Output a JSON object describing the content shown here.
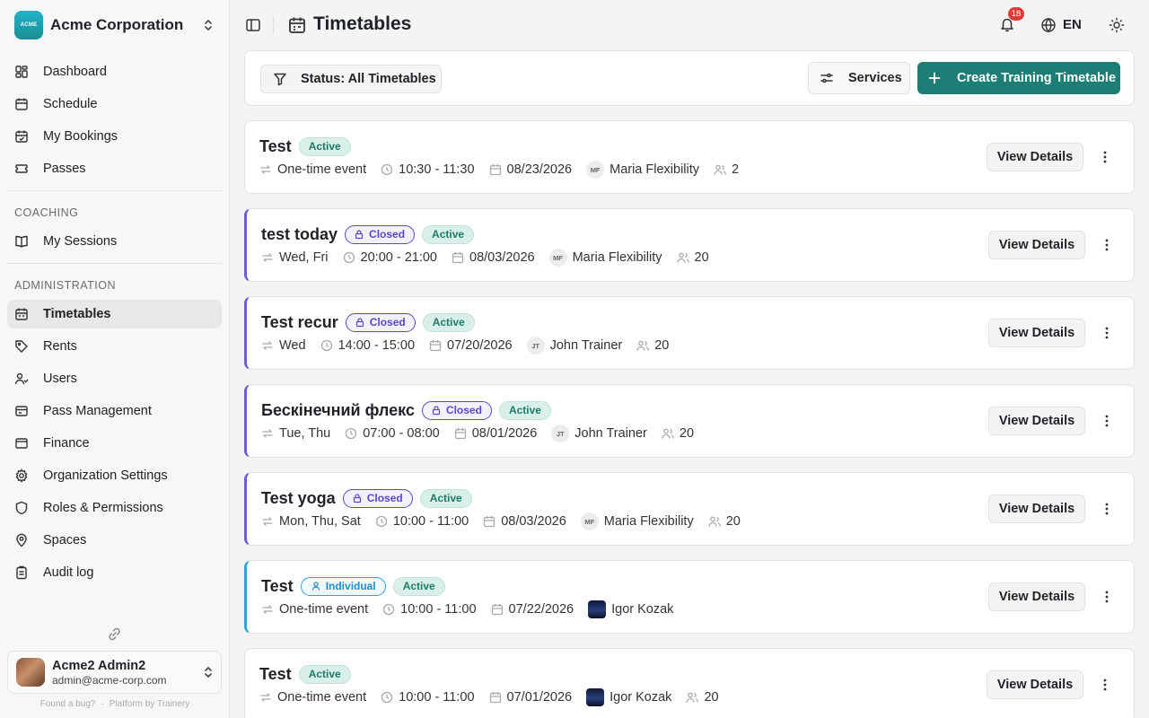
{
  "org": {
    "logo_text": "ACME",
    "name": "Acme Corporation"
  },
  "sidebar": {
    "main_items": [
      {
        "label": "Dashboard",
        "icon": "dashboard-icon"
      },
      {
        "label": "Schedule",
        "icon": "calendar-icon"
      },
      {
        "label": "My Bookings",
        "icon": "bookings-icon"
      },
      {
        "label": "Passes",
        "icon": "ticket-icon"
      }
    ],
    "coaching_heading": "COACHING",
    "coaching_items": [
      {
        "label": "My Sessions",
        "icon": "book-icon"
      }
    ],
    "admin_heading": "ADMINISTRATION",
    "admin_items": [
      {
        "label": "Timetables",
        "icon": "calendar-icon",
        "active": true
      },
      {
        "label": "Rents",
        "icon": "tag-icon"
      },
      {
        "label": "Users",
        "icon": "users-icon"
      },
      {
        "label": "Pass Management",
        "icon": "ticket-icon"
      },
      {
        "label": "Finance",
        "icon": "wallet-icon"
      },
      {
        "label": "Organization Settings",
        "icon": "gear-icon"
      },
      {
        "label": "Roles & Permissions",
        "icon": "shield-icon"
      },
      {
        "label": "Spaces",
        "icon": "map-pin-icon"
      },
      {
        "label": "Audit log",
        "icon": "clipboard-icon"
      }
    ]
  },
  "user": {
    "name": "Acme2 Admin2",
    "email": "admin@acme-corp.com"
  },
  "footer": {
    "bug_link": "Found a bug?",
    "separator": "·",
    "platform": "Platform by Trainery"
  },
  "header": {
    "title": "Timetables",
    "notifications_count": "18",
    "language": "EN"
  },
  "toolbar": {
    "status_filter": "Status: All Timetables",
    "services_label": "Services",
    "create_label": "Create Training Timetable"
  },
  "timetables": [
    {
      "title": "Test",
      "badges": [
        {
          "type": "active",
          "label": "Active"
        }
      ],
      "accent": "none",
      "recurrence": "One-time event",
      "time": "10:30 - 11:30",
      "date": "08/23/2026",
      "trainer_initials": "MF",
      "trainer": "Maria Flexibility",
      "capacity": "2"
    },
    {
      "title": "test today",
      "badges": [
        {
          "type": "closed",
          "label": "Closed"
        },
        {
          "type": "active",
          "label": "Active"
        }
      ],
      "accent": "purple",
      "recurrence": "Wed, Fri",
      "time": "20:00 - 21:00",
      "date": "08/03/2026",
      "trainer_initials": "MF",
      "trainer": "Maria Flexibility",
      "capacity": "20"
    },
    {
      "title": "Test recur",
      "badges": [
        {
          "type": "closed",
          "label": "Closed"
        },
        {
          "type": "active",
          "label": "Active"
        }
      ],
      "accent": "purple",
      "recurrence": "Wed",
      "time": "14:00 - 15:00",
      "date": "07/20/2026",
      "trainer_initials": "JT",
      "trainer": "John Trainer",
      "capacity": "20"
    },
    {
      "title": "Бескінечний флекс",
      "badges": [
        {
          "type": "closed",
          "label": "Closed"
        },
        {
          "type": "active",
          "label": "Active"
        }
      ],
      "accent": "purple",
      "recurrence": "Tue, Thu",
      "time": "07:00 - 08:00",
      "date": "08/01/2026",
      "trainer_initials": "JT",
      "trainer": "John Trainer",
      "capacity": "20"
    },
    {
      "title": "Test yoga",
      "badges": [
        {
          "type": "closed",
          "label": "Closed"
        },
        {
          "type": "active",
          "label": "Active"
        }
      ],
      "accent": "purple",
      "recurrence": "Mon, Thu, Sat",
      "time": "10:00 - 11:00",
      "date": "08/03/2026",
      "trainer_initials": "MF",
      "trainer": "Maria Flexibility",
      "capacity": "20"
    },
    {
      "title": "Test",
      "badges": [
        {
          "type": "individual",
          "label": "Individual"
        },
        {
          "type": "active",
          "label": "Active"
        }
      ],
      "accent": "blue",
      "recurrence": "One-time event",
      "time": "10:00 - 11:00",
      "date": "07/22/2026",
      "trainer_initials": "",
      "trainer": "Igor Kozak",
      "capacity": ""
    },
    {
      "title": "Test",
      "badges": [
        {
          "type": "active",
          "label": "Active"
        }
      ],
      "accent": "none",
      "recurrence": "One-time event",
      "time": "10:00 - 11:00",
      "date": "07/01/2026",
      "trainer_initials": "",
      "trainer": "Igor Kozak",
      "capacity": "20"
    }
  ],
  "view_details_label": "View Details",
  "colors": {
    "accent_teal": "#1c7e74",
    "closed_purple": "#5a48c6",
    "individual_blue": "#2ea4d8",
    "active_green": "#1d7a63",
    "notification_red": "#e53935"
  }
}
